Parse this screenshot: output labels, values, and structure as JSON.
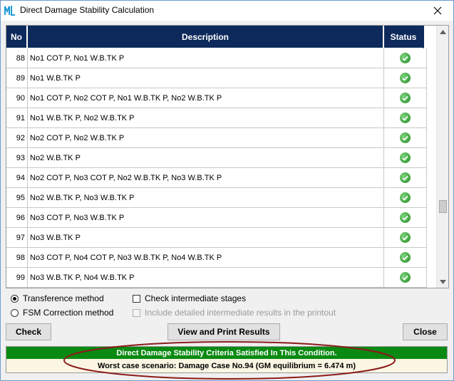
{
  "window": {
    "title": "Direct Damage Stability Calculation",
    "icon": "ml-app-icon",
    "close_icon": "close-icon"
  },
  "table": {
    "columns": {
      "no": "No",
      "description": "Description",
      "status": "Status"
    },
    "rows": [
      {
        "no": "88",
        "description": "No1 COT P, No1 W.B.TK P",
        "status": "ok"
      },
      {
        "no": "89",
        "description": "No1 W.B.TK P",
        "status": "ok"
      },
      {
        "no": "90",
        "description": "No1 COT P, No2 COT P, No1 W.B.TK P, No2 W.B.TK P",
        "status": "ok"
      },
      {
        "no": "91",
        "description": "No1 W.B.TK P, No2 W.B.TK P",
        "status": "ok"
      },
      {
        "no": "92",
        "description": "No2 COT P, No2 W.B.TK P",
        "status": "ok"
      },
      {
        "no": "93",
        "description": "No2 W.B.TK P",
        "status": "ok"
      },
      {
        "no": "94",
        "description": "No2 COT P, No3 COT P, No2 W.B.TK P, No3 W.B.TK P",
        "status": "ok"
      },
      {
        "no": "95",
        "description": "No2 W.B.TK P, No3 W.B.TK P",
        "status": "ok"
      },
      {
        "no": "96",
        "description": "No3 COT P, No3 W.B.TK P",
        "status": "ok"
      },
      {
        "no": "97",
        "description": "No3 W.B.TK P",
        "status": "ok"
      },
      {
        "no": "98",
        "description": "No3 COT P, No4 COT P, No3 W.B.TK P, No4 W.B.TK P",
        "status": "ok"
      },
      {
        "no": "99",
        "description": "No3 W.B.TK P, No4 W.B.TK P",
        "status": "ok"
      }
    ],
    "scroll_position": 0.72
  },
  "options": {
    "transference_label": "Transference method",
    "transference_selected": true,
    "fsm_label": "FSM Correction method",
    "fsm_selected": false,
    "check_intermediate_label": "Check intermediate stages",
    "check_intermediate_checked": false,
    "include_detailed_label": "Include detailed intermediate results in the printout",
    "include_detailed_enabled": false
  },
  "buttons": {
    "check": "Check",
    "view_print": "View and Print Results",
    "close": "Close"
  },
  "status": {
    "criteria": "Direct Damage Stability Criteria Satisfied In This Condition.",
    "worst_case": "Worst case scenario: Damage Case No.94 (GM equilibrium = 6.474 m)"
  },
  "colors": {
    "header_bg": "#0e2a5c",
    "status_green": "#0a8a12",
    "highlight": "#8b1a1a"
  }
}
